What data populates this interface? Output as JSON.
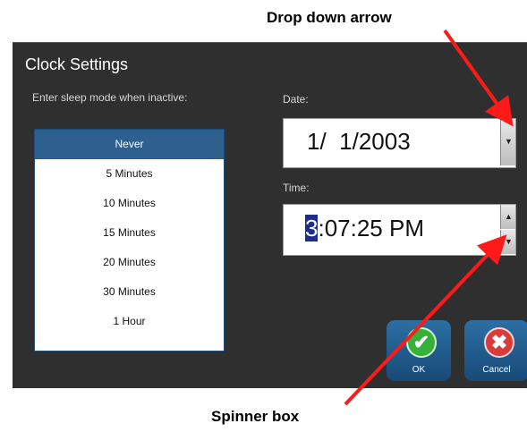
{
  "callouts": {
    "top": "Drop down arrow",
    "bottom": "Spinner box"
  },
  "dialog": {
    "title": "Clock Settings",
    "sleep_label": "Enter sleep mode when inactive:",
    "sleep_options": [
      "Never",
      "5 Minutes",
      "10 Minutes",
      "15 Minutes",
      "20 Minutes",
      "30 Minutes",
      "1 Hour"
    ],
    "selected_sleep_option": "Never",
    "date_label": "Date:",
    "date_value": "1/  1/2003",
    "time_label": "Time:",
    "time_selected_digit": "3",
    "time_rest": ":07:25 PM",
    "ok_label": "OK",
    "cancel_label": "Cancel"
  },
  "colors": {
    "dialog_bg": "#2f2f2f",
    "selection": "#2d5f8f",
    "arrow": "#ff1a1a"
  },
  "icons": [
    "chevron-down-icon",
    "chevron-up-icon",
    "check-icon",
    "close-icon"
  ]
}
